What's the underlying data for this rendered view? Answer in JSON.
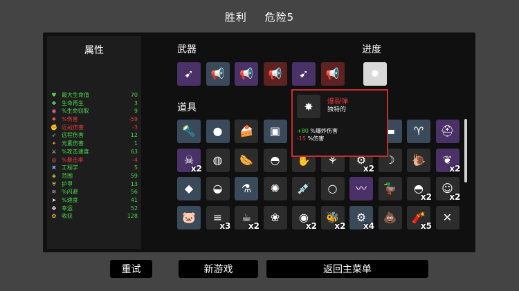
{
  "header": {
    "result": "胜利",
    "danger": "危险5"
  },
  "stats": {
    "title": "属性",
    "rows": [
      {
        "icon": "♥",
        "color": "#5fd35f",
        "label": "最大生命值",
        "value": "70",
        "tone": "pos"
      },
      {
        "icon": "✚",
        "color": "#5fd35f",
        "label": "生命再生",
        "value": "3",
        "tone": "pos"
      },
      {
        "icon": "◉",
        "color": "#e05a8a",
        "label": "%生命窃取",
        "value": "9",
        "tone": "pos"
      },
      {
        "icon": "✸",
        "color": "#e65a5a",
        "label": "%伤害",
        "value": "-59",
        "tone": "neg"
      },
      {
        "icon": "✊",
        "color": "#e65a5a",
        "label": "近战伤害",
        "value": "-3",
        "tone": "neg"
      },
      {
        "icon": "➶",
        "color": "#7fc6f0",
        "label": "远程伤害",
        "value": "12",
        "tone": "pos"
      },
      {
        "icon": "✦",
        "color": "#f08a3a",
        "label": "元素伤害",
        "value": "1",
        "tone": "pos"
      },
      {
        "icon": "⚔",
        "color": "#e6e6e6",
        "label": "%攻击速度",
        "value": "63",
        "tone": "pos"
      },
      {
        "icon": "◎",
        "color": "#e65a5a",
        "label": "%暴击率",
        "value": "-4",
        "tone": "neg"
      },
      {
        "icon": "✖",
        "color": "#7fa6e0",
        "label": "工程学",
        "value": "5",
        "tone": "pos"
      },
      {
        "icon": "◈",
        "color": "#e6c23a",
        "label": "范围",
        "value": "59",
        "tone": "pos"
      },
      {
        "icon": "⛨",
        "color": "#e6c23a",
        "label": "护甲",
        "value": "13",
        "tone": "pos"
      },
      {
        "icon": "≋",
        "color": "#d9a0f0",
        "label": "%闪避",
        "value": "56",
        "tone": "pos"
      },
      {
        "icon": "➤",
        "color": "#e6e6e6",
        "label": "%速度",
        "value": "41",
        "tone": "pos"
      },
      {
        "icon": "✤",
        "color": "#e6e6e6",
        "label": "幸运",
        "value": "52",
        "tone": "pos"
      },
      {
        "icon": "✿",
        "color": "#e6c23a",
        "label": "收获",
        "value": "128",
        "tone": "pos"
      }
    ]
  },
  "sections": {
    "weapons": "武器",
    "progress": "进度",
    "items": "道具"
  },
  "weapons": [
    {
      "tier": "rare",
      "icon": "rocket-launcher-icon",
      "glyph": "➹"
    },
    {
      "tier": "uncommon",
      "icon": "megaphone-icon",
      "glyph": "📢"
    },
    {
      "tier": "rare",
      "icon": "megaphone-icon",
      "glyph": "📢"
    },
    {
      "tier": "legendary",
      "icon": "megaphone-icon",
      "glyph": "📢"
    },
    {
      "tier": "rare",
      "icon": "rocket-launcher-icon",
      "glyph": "➹"
    },
    {
      "tier": "legendary",
      "icon": "megaphone-icon",
      "glyph": "📢"
    }
  ],
  "progress": [
    {
      "tier": "white",
      "icon": "explosive-shell-icon",
      "glyph": "✸"
    }
  ],
  "items": [
    [
      {
        "tier": "uncommon",
        "icon": "flashlight-icon",
        "glyph": "🔦",
        "qty": ""
      },
      {
        "tier": "uncommon",
        "icon": "ghost-blob-icon",
        "glyph": "●",
        "qty": ""
      },
      {
        "tier": "common",
        "icon": "cake-icon",
        "glyph": "🍰",
        "qty": ""
      },
      {
        "tier": "uncommon",
        "icon": "vest-icon",
        "glyph": "▣",
        "qty": ""
      },
      {
        "tier": "hidden",
        "icon": "",
        "glyph": "",
        "qty": ""
      },
      {
        "tier": "hidden",
        "icon": "",
        "glyph": "",
        "qty": ""
      },
      {
        "tier": "hidden",
        "icon": "",
        "glyph": "",
        "qty": ""
      },
      {
        "tier": "uncommon",
        "icon": "bread-icon",
        "glyph": "▬",
        "qty": ""
      },
      {
        "tier": "uncommon",
        "icon": "horns-icon",
        "glyph": "♈",
        "qty": ""
      },
      {
        "tier": "rare",
        "icon": "knight-helmet-icon",
        "glyph": "⛑",
        "qty": ""
      }
    ],
    [
      {
        "tier": "rare",
        "icon": "zombie-head-icon",
        "glyph": "☠",
        "qty": "x2"
      },
      {
        "tier": "common",
        "icon": "coin-icon",
        "glyph": "◍",
        "qty": ""
      },
      {
        "tier": "common",
        "icon": "sausage-icon",
        "glyph": "🌭",
        "qty": ""
      },
      {
        "tier": "common",
        "icon": "helmet-icon",
        "glyph": "◓",
        "qty": ""
      },
      {
        "tier": "common",
        "icon": "glove-icon",
        "glyph": "✋",
        "qty": ""
      },
      {
        "tier": "common",
        "icon": "root-icon",
        "glyph": "⚘",
        "qty": ""
      },
      {
        "tier": "common",
        "icon": "robot-icon",
        "glyph": "⚙",
        "qty": "x2"
      },
      {
        "tier": "common",
        "icon": "claw-icon",
        "glyph": "☽",
        "qty": ""
      },
      {
        "tier": "common",
        "icon": "snail-icon",
        "glyph": "🐌",
        "qty": ""
      },
      {
        "tier": "rare",
        "icon": "wings-icon",
        "glyph": "❦",
        "qty": "x2"
      }
    ],
    [
      {
        "tier": "uncommon",
        "icon": "grenade-icon",
        "glyph": "◆",
        "qty": ""
      },
      {
        "tier": "common",
        "icon": "bowler-hat-icon",
        "glyph": "◒",
        "qty": ""
      },
      {
        "tier": "uncommon",
        "icon": "potion-icon",
        "glyph": "⚗",
        "qty": ""
      },
      {
        "tier": "common",
        "icon": "propeller-cap-icon",
        "glyph": "✺",
        "qty": ""
      },
      {
        "tier": "common",
        "icon": "syringe-icon",
        "glyph": "💉",
        "qty": ""
      },
      {
        "tier": "common",
        "icon": "lasso-icon",
        "glyph": "○",
        "qty": ""
      },
      {
        "tier": "rare",
        "icon": "scarf-icon",
        "glyph": "〰",
        "qty": ""
      },
      {
        "tier": "common",
        "icon": "rubber-duck-icon",
        "glyph": "🦆",
        "qty": ""
      },
      {
        "tier": "common",
        "icon": "beanie-icon",
        "glyph": "◓",
        "qty": "x2"
      },
      {
        "tier": "common",
        "icon": "ghost-icon",
        "glyph": "☺",
        "qty": "x2"
      }
    ],
    [
      {
        "tier": "uncommon",
        "icon": "pig-icon",
        "glyph": "🐷",
        "qty": ""
      },
      {
        "tier": "common",
        "icon": "claw-marks-icon",
        "glyph": "≡",
        "qty": "x3"
      },
      {
        "tier": "common",
        "icon": "coffee-cup-icon",
        "glyph": "☕",
        "qty": "x2"
      },
      {
        "tier": "common",
        "icon": "plant-icon",
        "glyph": "❀",
        "qty": ""
      },
      {
        "tier": "common",
        "icon": "eye-icon",
        "glyph": "◉",
        "qty": "x2"
      },
      {
        "tier": "common",
        "icon": "bee-icon",
        "glyph": "🐝",
        "qty": "x2"
      },
      {
        "tier": "uncommon",
        "icon": "turret-icon",
        "glyph": "⚙",
        "qty": "x4"
      },
      {
        "tier": "common",
        "icon": "poop-icon",
        "glyph": "💩",
        "qty": ""
      },
      {
        "tier": "common",
        "icon": "dynamite-icon",
        "glyph": "🧨",
        "qty": "x5"
      },
      {
        "tier": "common",
        "icon": "crossed-out-icon",
        "glyph": "✕",
        "qty": ""
      }
    ]
  ],
  "tooltip": {
    "name": "爆裂弹",
    "type": "独特的",
    "icon": "explosive-shell-icon",
    "glyph": "✸",
    "effects": [
      {
        "value": "+80",
        "text": " %爆炸伤害",
        "tone": "pos"
      },
      {
        "value": "-15",
        "text": " %伤害",
        "tone": "neg"
      }
    ]
  },
  "buttons": {
    "retry": "重试",
    "new_game": "新游戏",
    "main_menu": "返回主菜单"
  }
}
